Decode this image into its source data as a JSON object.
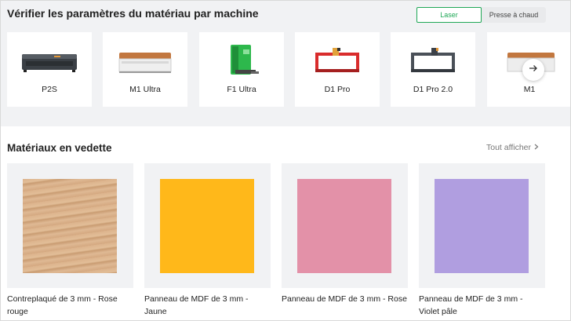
{
  "machine_section": {
    "title": "Vérifier les paramètres du matériau par machine",
    "toggle": {
      "laser": "Laser",
      "heat_press": "Presse à chaud",
      "active": "Laser"
    },
    "machines": [
      {
        "label": "P2S",
        "icon": "p2s-laser-image"
      },
      {
        "label": "M1 Ultra",
        "icon": "m1-ultra-image"
      },
      {
        "label": "F1 Ultra",
        "icon": "f1-ultra-image"
      },
      {
        "label": "D1 Pro",
        "icon": "d1-pro-image"
      },
      {
        "label": "D1 Pro 2.0",
        "icon": "d1-pro-2-image"
      },
      {
        "label": "M1",
        "icon": "m1-image"
      }
    ],
    "next_icon": "arrow-right-icon"
  },
  "featured": {
    "title": "Matériaux en vedette",
    "see_all": "Tout afficher",
    "materials": [
      {
        "name": "Contreplaqué de 3 mm - Rose rouge",
        "color": "#d9b08a"
      },
      {
        "name": "Panneau de MDF de 3 mm - Jaune",
        "color": "#ffb81a"
      },
      {
        "name": "Panneau de MDF de 3 mm - Rose",
        "color": "#e391a8"
      },
      {
        "name": "Panneau de MDF de 3 mm - Violet pâle",
        "color": "#b09ee0"
      }
    ]
  },
  "colors": {
    "accent": "#1fa856",
    "section_bg": "#f1f2f4"
  }
}
